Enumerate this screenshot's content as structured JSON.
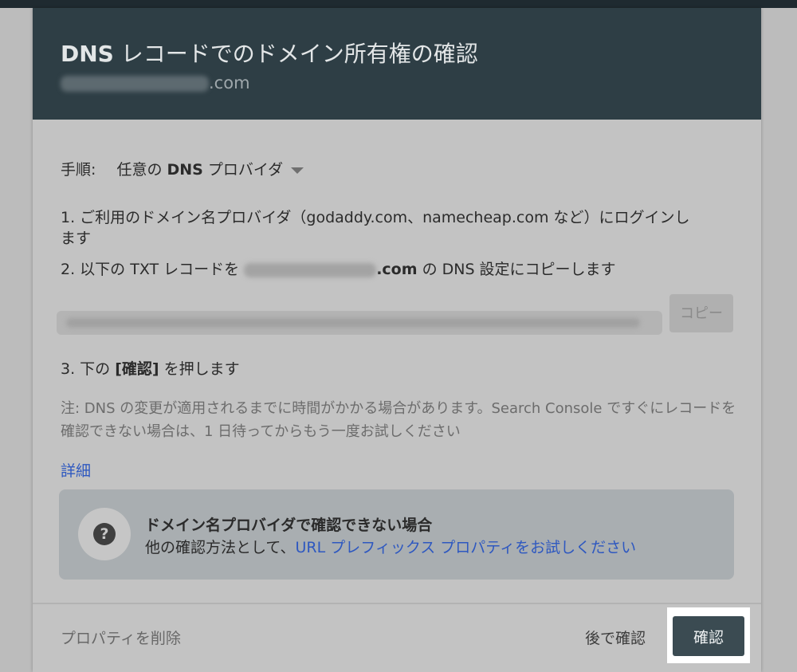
{
  "dialog": {
    "title_bold": "DNS",
    "title_rest": " レコードでのドメイン所有権の確認",
    "subtitle_suffix": ".com"
  },
  "instructions": {
    "label": "手順:",
    "provider_prefix": "任意の ",
    "provider_bold": "DNS",
    "provider_suffix": " プロバイダ"
  },
  "steps": {
    "step1_line1": "1. ご利用のドメイン名プロバイダ（godaddy.com、namecheap.com など）にログインし",
    "step1_line2": "ます",
    "step2_prefix": "2. 以下の TXT レコードを ",
    "step2_domain_suffix": ".com",
    "step2_suffix": " の DNS 設定にコピーします",
    "step3_prefix": "3. 下の ",
    "step3_bold": "[確認]",
    "step3_suffix": " を押します"
  },
  "copy_button": "コピー",
  "note": "注: DNS の変更が適用されるまでに時間がかかる場合があります。Search Console ですぐにレコードを確認できない場合は、1 日待ってからもう一度お試しください",
  "details_link": "詳細",
  "info_card": {
    "title": "ドメイン名プロバイダで確認できない場合",
    "body_prefix": "他の確認方法として、",
    "link": "URL プレフィックス プロパティをお試しください"
  },
  "footer": {
    "delete": "プロパティを削除",
    "later": "後で確認",
    "verify": "確認"
  },
  "colors": {
    "header_bg": "#2e3e45",
    "link": "#2e58c0",
    "primary_button": "#3b4b52"
  }
}
